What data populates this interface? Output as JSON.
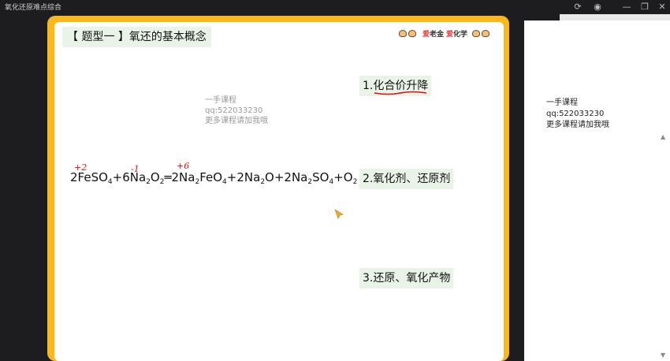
{
  "window": {
    "title": "氧化还原难点综合",
    "buttons": {
      "refresh": "⟳",
      "eye": "◉",
      "minimize": "—",
      "restore": "❐",
      "close": "✕"
    }
  },
  "slide": {
    "topic_title": "【 题型一 】氧还的基本概念",
    "brand": {
      "love1": "爱",
      "teacher": "老金",
      "love2": "爱",
      "chem": "化学"
    },
    "watermark": {
      "line1": "一手课程",
      "line2": "qq:522033230",
      "line3": "更多课程请加我哦"
    },
    "equation": {
      "p1": "2FeSO",
      "s1": "4",
      "p2": "+6Na",
      "s2": "2",
      "p3": "O",
      "s3": "2",
      "p4": "═2Na",
      "s4": "2",
      "p5": "FeO",
      "s5": "4",
      "p6": "+2Na",
      "s6": "2",
      "p7": "O+2Na",
      "s7": "2",
      "p8": "SO",
      "s8": "4",
      "p9": "+O",
      "s9": "2",
      "p10": "↑"
    },
    "annotations": {
      "fe_before": "+2",
      "o_peroxide": "-1",
      "fe_after": "+6"
    },
    "concepts": [
      "1.化合价升降",
      "2.氧化剂、还原剂",
      "3.还原、氧化产物"
    ]
  },
  "side_panel": {
    "watermark": {
      "line1": "一手课程",
      "line2": "qq:522033230",
      "line3": "更多课程请加我哦"
    }
  },
  "colors": {
    "frame": "#f9b91e",
    "title_bg": "#eaf3e7",
    "annotation": "#dd1111",
    "titlebar": "#1d1d1f"
  }
}
